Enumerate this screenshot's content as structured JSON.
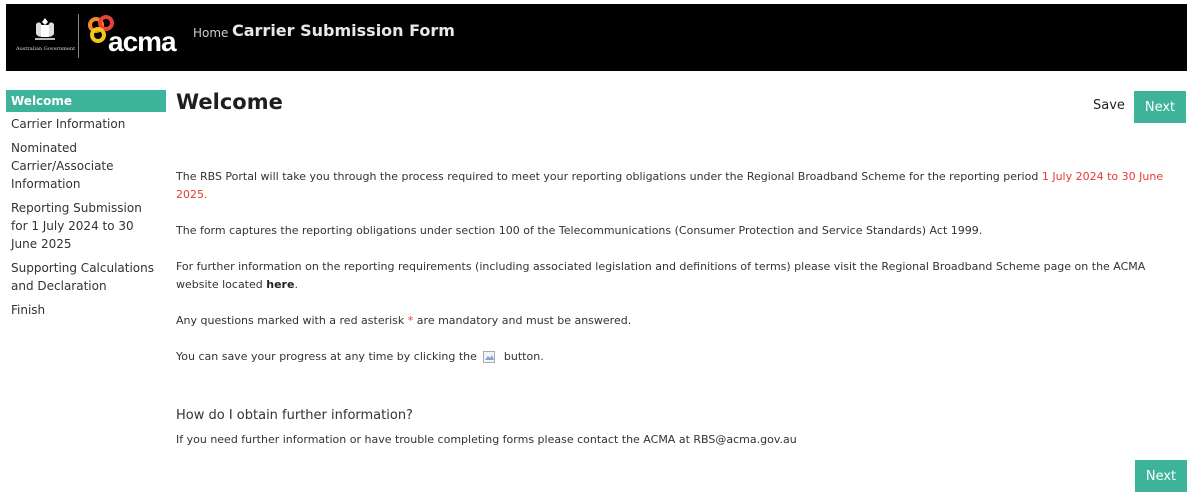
{
  "header": {
    "gov_text": "Australian Government",
    "logo_text": "acma",
    "home_label": "Home",
    "title": "Carrier Submission Form"
  },
  "sidebar": {
    "items": [
      {
        "label": "Welcome",
        "active": true
      },
      {
        "label": "Carrier Information"
      },
      {
        "label": "Nominated Carrier/Associate Information"
      },
      {
        "label": "Reporting Submission for 1 July 2024 to 30 June 2025"
      },
      {
        "label": "Supporting Calculations and Declaration"
      },
      {
        "label": "Finish"
      }
    ]
  },
  "main": {
    "title": "Welcome",
    "save_label": "Save",
    "next_label": "Next",
    "paragraphs": {
      "p1_text": "The RBS Portal will take you through the process required to meet your reporting obligations under the Regional Broadband Scheme for the reporting period ",
      "p1_highlight": "1 July 2024 to 30 June 2025",
      "p1_end": ".",
      "p2": "The form captures the reporting obligations under section 100 of the Telecommunications (Consumer Protection and Service Standards) Act 1999.",
      "p3_text": "For further information on the reporting requirements (including associated legislation and definitions of terms) please visit the Regional Broadband Scheme page on the ACMA website located ",
      "p3_link": "here",
      "p3_end": ".",
      "p4_start": "Any questions marked with a red asterisk ",
      "p4_asterisk": "*",
      "p4_end": " are mandatory and must be answered.",
      "p5_start": "You can save your progress at any time by clicking the ",
      "p5_end": " button."
    },
    "faq_heading": "How do I obtain further information?",
    "faq_text": "If you need further information or have trouble completing forms please contact the ACMA at RBS@acma.gov.au"
  },
  "colors": {
    "accent": "#3db39a",
    "header_bg": "#000000",
    "highlight": "#e53935"
  }
}
